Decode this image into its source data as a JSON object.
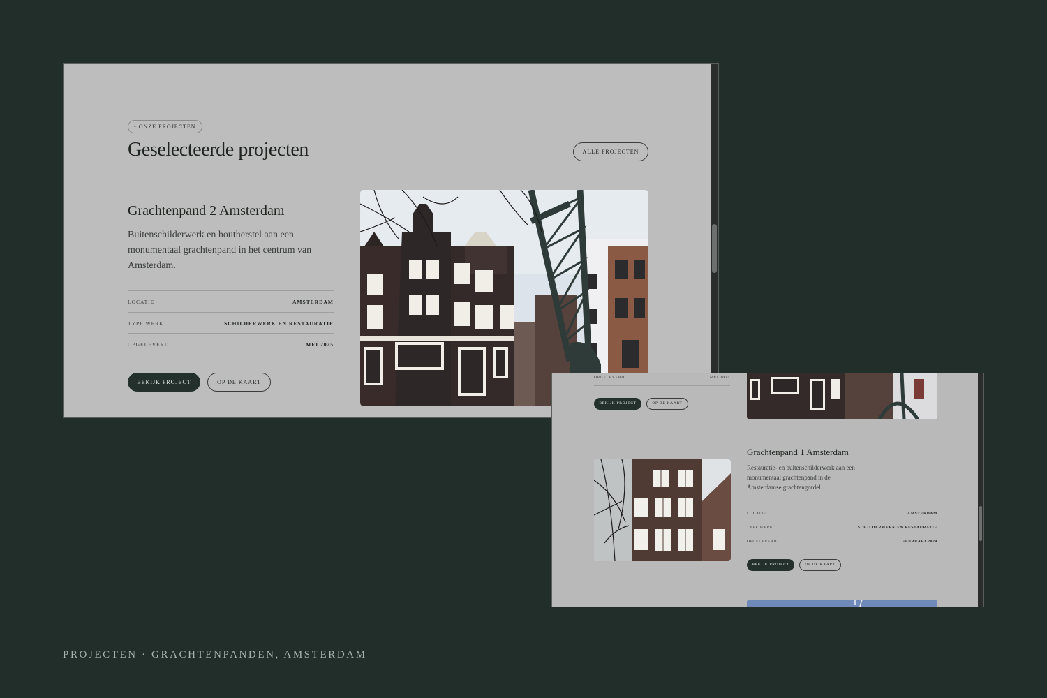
{
  "window1": {
    "badge": "• ONZE PROJECTEN",
    "heading": "Geselecteerde projecten",
    "all_button": "ALLE PROJECTEN",
    "project": {
      "title": "Grachtenpand 2 Amsterdam",
      "description": "Buitenschilderwerk en houtherstel aan een monumentaal grachtenpand in het centrum van Amsterdam.",
      "specs": [
        {
          "label": "LOCATIE",
          "value": "AMSTERDAM"
        },
        {
          "label": "TYPE WERK",
          "value": "SCHILDERWERK EN RESTAURATIE"
        },
        {
          "label": "OPGELEVERD",
          "value": "MEI 2025"
        }
      ],
      "view_button": "BEKIJK PROJECT",
      "map_button": "OP DE KAART"
    }
  },
  "window2": {
    "top_spec": {
      "label": "OPGELEVERD",
      "value": "MEI 2025"
    },
    "top_view_button": "BEKIJK PROJECT",
    "top_map_button": "OP DE KAART",
    "project": {
      "title": "Grachtenpand 1 Amsterdam",
      "description": "Restauratie- en buitenschilderwerk aan een monumentaal grachtenpand in de Amsterdamse grachtengordel.",
      "specs": [
        {
          "label": "LOCATIE",
          "value": "AMSTERDAM"
        },
        {
          "label": "TYPE WERK",
          "value": "SCHILDERWERK EN RESTAURATIE"
        },
        {
          "label": "OPGELEVERD",
          "value": "FEBRUARI 2024"
        }
      ],
      "view_button": "BEKIJK PROJECT",
      "map_button": "OP DE KAART"
    }
  },
  "caption": "PROJECTEN · GRACHTENPANDEN, AMSTERDAM",
  "colors": {
    "background": "#212e29",
    "panel": "#bdbdbd",
    "dark_button": "#23302b",
    "text": "#1f2420"
  }
}
